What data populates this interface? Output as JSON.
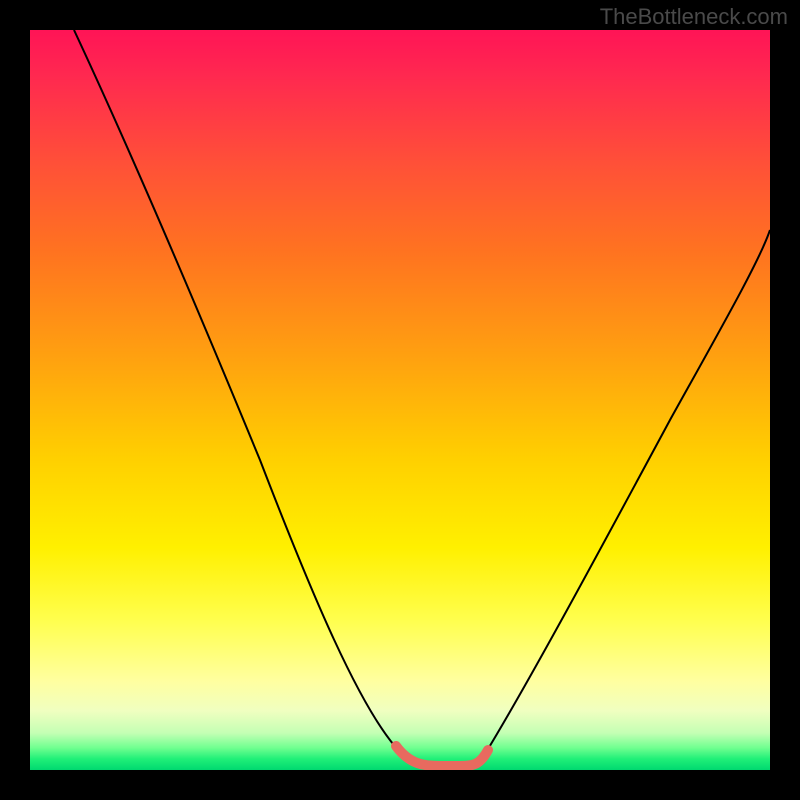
{
  "watermark": "TheBottleneck.com",
  "chart_data": {
    "type": "line",
    "title": "",
    "xlabel": "",
    "ylabel": "",
    "xlim": [
      0,
      100
    ],
    "ylim": [
      0,
      100
    ],
    "series": [
      {
        "name": "curve",
        "points": [
          {
            "x": 6,
            "y": 100
          },
          {
            "x": 11,
            "y": 90
          },
          {
            "x": 17,
            "y": 77
          },
          {
            "x": 23,
            "y": 63
          },
          {
            "x": 29,
            "y": 49
          },
          {
            "x": 35,
            "y": 35
          },
          {
            "x": 40,
            "y": 23
          },
          {
            "x": 46,
            "y": 10
          },
          {
            "x": 50,
            "y": 3
          },
          {
            "x": 53,
            "y": 0.5
          },
          {
            "x": 58,
            "y": 0.5
          },
          {
            "x": 61,
            "y": 3
          },
          {
            "x": 65,
            "y": 10
          },
          {
            "x": 72,
            "y": 25
          },
          {
            "x": 79,
            "y": 40
          },
          {
            "x": 86,
            "y": 53
          },
          {
            "x": 93,
            "y": 64
          },
          {
            "x": 100,
            "y": 73
          }
        ]
      },
      {
        "name": "highlight-segment",
        "color": "#e86a5f",
        "points": [
          {
            "x": 50,
            "y": 3
          },
          {
            "x": 53,
            "y": 0.5
          },
          {
            "x": 58,
            "y": 0.5
          },
          {
            "x": 61,
            "y": 3
          }
        ]
      }
    ],
    "gradient_stops": [
      {
        "pos": 0,
        "color": "#ff1456"
      },
      {
        "pos": 50,
        "color": "#ffd000"
      },
      {
        "pos": 100,
        "color": "#00d870"
      }
    ]
  }
}
